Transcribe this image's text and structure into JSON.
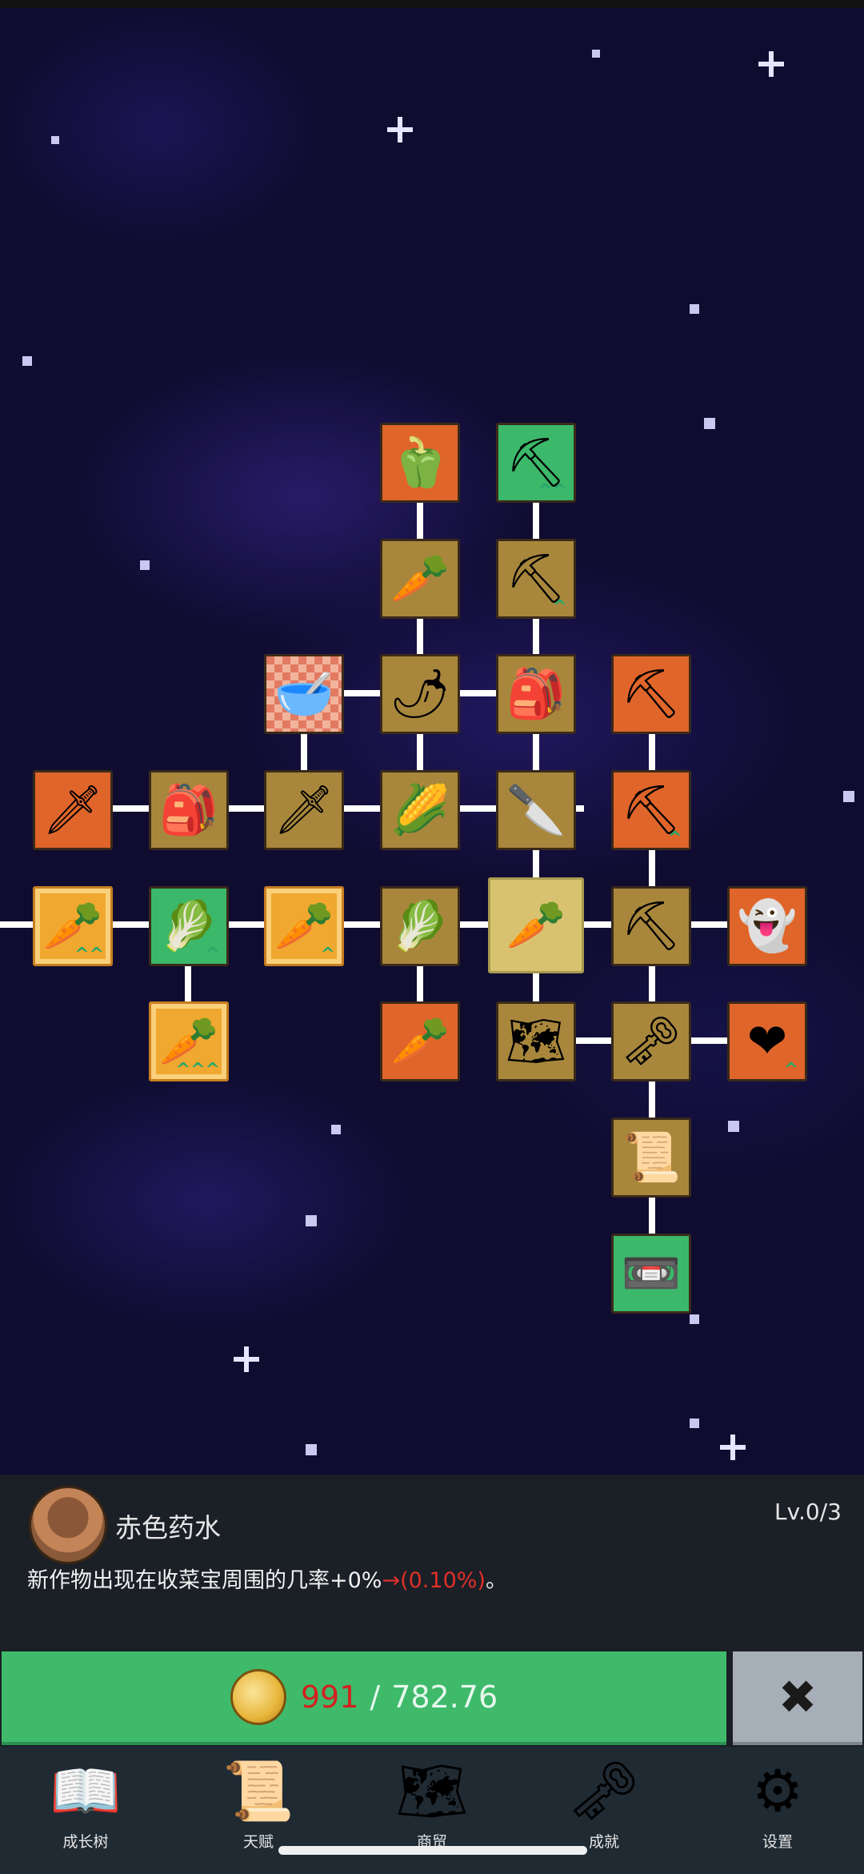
{
  "skill_tree": {
    "nodes": [
      {
        "id": "n1",
        "icon": "pepper-icon",
        "glyph": "🫑",
        "color": "orange",
        "chevrons": ""
      },
      {
        "id": "n2",
        "icon": "shovel-icon",
        "glyph": "⛏",
        "color": "green",
        "chevrons": "^^"
      },
      {
        "id": "n3",
        "icon": "radish-icon",
        "glyph": "🥕",
        "color": "brown",
        "chevrons": ""
      },
      {
        "id": "n4",
        "icon": "shovel-icon",
        "glyph": "⛏",
        "color": "brown",
        "chevrons": "^"
      },
      {
        "id": "n5",
        "icon": "pot-icon",
        "glyph": "🥣",
        "color": "checker",
        "chevrons": ""
      },
      {
        "id": "n6",
        "icon": "chili-icon",
        "glyph": "🌶",
        "color": "brown",
        "chevrons": ""
      },
      {
        "id": "n7",
        "icon": "backpack-icon",
        "glyph": "🎒",
        "color": "brown",
        "chevrons": ""
      },
      {
        "id": "n8",
        "icon": "pickaxe-icon",
        "glyph": "⛏",
        "color": "orange",
        "chevrons": ""
      },
      {
        "id": "n9",
        "icon": "sword-icon",
        "glyph": "🗡",
        "color": "orange",
        "chevrons": ""
      },
      {
        "id": "n10",
        "icon": "backpack-icon",
        "glyph": "🎒",
        "color": "brown",
        "chevrons": ""
      },
      {
        "id": "n11",
        "icon": "sword-icon",
        "glyph": "🗡",
        "color": "brown",
        "chevrons": ""
      },
      {
        "id": "n12",
        "icon": "corn-icon",
        "glyph": "🌽",
        "color": "brown",
        "chevrons": ""
      },
      {
        "id": "n13",
        "icon": "knife-icon",
        "glyph": "🔪",
        "color": "brown",
        "chevrons": ""
      },
      {
        "id": "n14",
        "icon": "pickaxe-icon",
        "glyph": "⛏",
        "color": "orange",
        "chevrons": "^"
      },
      {
        "id": "n15",
        "icon": "golden-carrot-icon",
        "glyph": "🥕",
        "color": "gold",
        "chevrons": "^^"
      },
      {
        "id": "n16",
        "icon": "cabbage-icon",
        "glyph": "🥬",
        "color": "green",
        "chevrons": "^"
      },
      {
        "id": "n17",
        "icon": "golden-carrot-icon",
        "glyph": "🥕",
        "color": "gold",
        "chevrons": "^"
      },
      {
        "id": "n18",
        "icon": "cabbage-icon",
        "glyph": "🥬",
        "color": "brown",
        "chevrons": ""
      },
      {
        "id": "n19",
        "icon": "carrot-icon",
        "glyph": "🥕",
        "color": "selected",
        "chevrons": ""
      },
      {
        "id": "n20",
        "icon": "pickaxe-icon",
        "glyph": "⛏",
        "color": "brown",
        "chevrons": ""
      },
      {
        "id": "n21",
        "icon": "ghost-icon",
        "glyph": "👻",
        "color": "orange",
        "chevrons": ""
      },
      {
        "id": "n22",
        "icon": "golden-carrot-icon",
        "glyph": "🥕",
        "color": "gold",
        "chevrons": "^^^"
      },
      {
        "id": "n23",
        "icon": "parsnip-icon",
        "glyph": "🥕",
        "color": "orange",
        "chevrons": ""
      },
      {
        "id": "n24",
        "icon": "map-icon",
        "glyph": "🗺",
        "color": "brown",
        "chevrons": ""
      },
      {
        "id": "n25",
        "icon": "key-icon",
        "glyph": "🗝",
        "color": "brown",
        "chevrons": ""
      },
      {
        "id": "n26",
        "icon": "heart-icon",
        "glyph": "❤",
        "color": "orange",
        "chevrons": "^"
      },
      {
        "id": "n27",
        "icon": "scroll-icon",
        "glyph": "📜",
        "color": "brown",
        "chevrons": ""
      },
      {
        "id": "n28",
        "icon": "cassette-icon",
        "glyph": "📼",
        "color": "green",
        "chevrons": ""
      }
    ]
  },
  "detail": {
    "icon": "pot-icon",
    "name": "赤色药水",
    "level": "Lv.0/3",
    "desc_main": "新作物出现在收菜宝周围的几率+0%",
    "desc_highlight": "→(0.10%)",
    "desc_end": "。"
  },
  "purchase": {
    "coin_icon": "coin-icon",
    "cost": "991",
    "separator": "/",
    "balance": "782.76",
    "close_glyph": "✖"
  },
  "nav": [
    {
      "label": "成长树",
      "icon": "book-icon",
      "glyph": "📖"
    },
    {
      "label": "天赋",
      "icon": "scroll-icon",
      "glyph": "📜"
    },
    {
      "label": "商贸",
      "icon": "map-icon",
      "glyph": "🗺"
    },
    {
      "label": "成就",
      "icon": "key-icon",
      "glyph": "🗝"
    },
    {
      "label": "设置",
      "icon": "gear-icon",
      "glyph": "⚙"
    }
  ],
  "colors": {
    "accent_green": "#3fba6b",
    "cost_red": "#d42020",
    "panel_bg": "#1b1f26",
    "nav_bg": "#1f2a33"
  }
}
